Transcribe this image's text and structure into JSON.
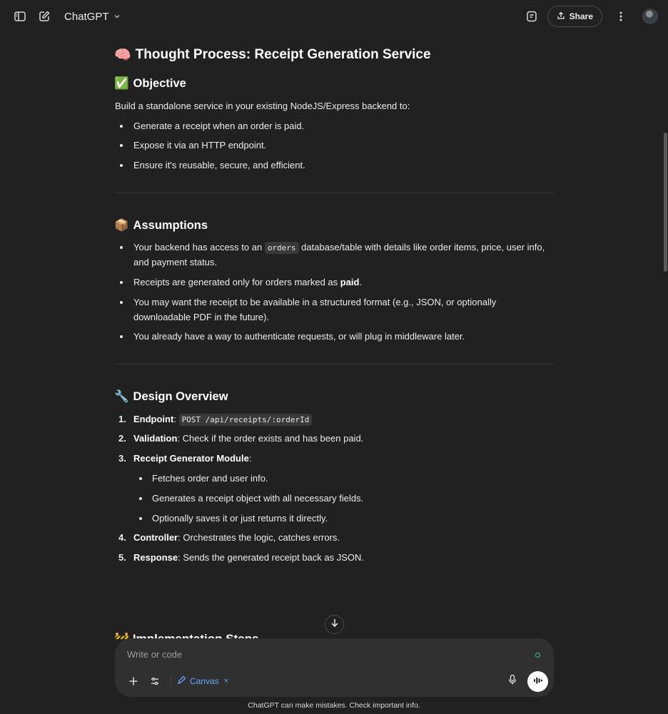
{
  "header": {
    "sidebar_toggle_icon": "sidebar-icon",
    "new_chat_icon": "compose-icon",
    "model_name": "ChatGPT",
    "canvas_icon": "document-icon",
    "share_label": "Share"
  },
  "content": {
    "title_emoji": "🧠",
    "title": "Thought Process: Receipt Generation Service",
    "objective": {
      "emoji": "✅",
      "heading": "Objective",
      "intro": "Build a standalone service in your existing NodeJS/Express backend to:",
      "bullets": [
        "Generate a receipt when an order is paid.",
        "Expose it via an HTTP endpoint.",
        "Ensure it's reusable, secure, and efficient."
      ]
    },
    "assumptions": {
      "emoji": "📦",
      "heading": "Assumptions",
      "b1_pre": "Your backend has access to an ",
      "b1_code": "orders",
      "b1_post": " database/table with details like order items, price, user info, and payment status.",
      "b2_pre": "Receipts are generated only for orders marked as ",
      "b2_bold": "paid",
      "b2_post": ".",
      "b3": "You may want the receipt to be available in a structured format (e.g., JSON, or optionally downloadable PDF in the future).",
      "b4": "You already have a way to authenticate requests, or will plug in middleware later."
    },
    "design": {
      "emoji": "🔧",
      "heading": "Design Overview",
      "items": [
        {
          "num": "1.",
          "label": "Endpoint",
          "rest": ": ",
          "code": "POST /api/receipts/:orderId"
        },
        {
          "num": "2.",
          "label": "Validation",
          "rest": ": Check if the order exists and has been paid."
        },
        {
          "num": "3.",
          "label": "Receipt Generator Module",
          "rest": ":"
        },
        {
          "num": "4.",
          "label": "Controller",
          "rest": ": Orchestrates the logic, catches errors."
        },
        {
          "num": "5.",
          "label": "Response",
          "rest": ": Sends the generated receipt back as JSON."
        }
      ],
      "sub_bullets": [
        "Fetches order and user info.",
        "Generates a receipt object with all necessary fields.",
        "Optionally saves it or just returns it directly."
      ]
    },
    "next_heading_emoji": "🚧",
    "next_heading": "Implementation Steps"
  },
  "composer": {
    "placeholder": "Write or code",
    "canvas_label": "Canvas",
    "canvas_remove": "×"
  },
  "footer": "ChatGPT can make mistakes. Check important info.",
  "colors": {
    "background": "#212121",
    "composer": "#303030",
    "accent": "#6aa8ff"
  }
}
